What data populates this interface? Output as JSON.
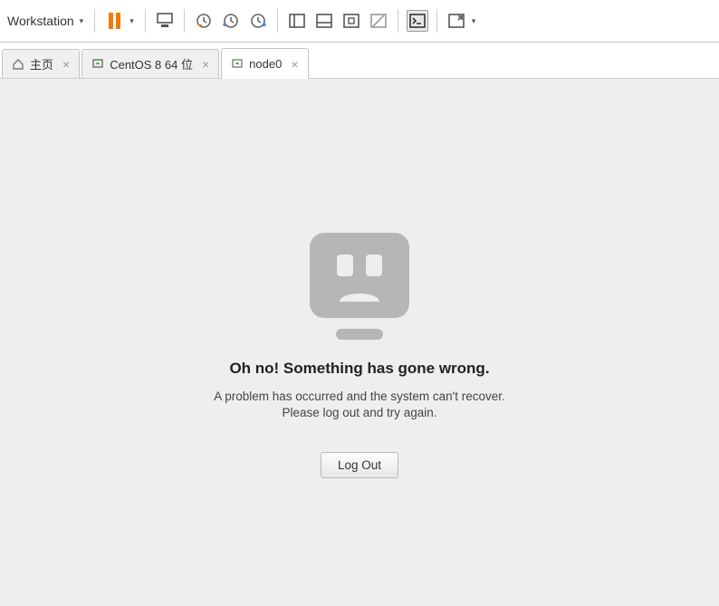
{
  "toolbar": {
    "workstation_label": "Workstation",
    "dropdown_suffix": "▼"
  },
  "tabs": [
    {
      "label": "主页",
      "type": "home"
    },
    {
      "label": "CentOS 8 64 位",
      "type": "vm"
    },
    {
      "label": "node0",
      "type": "vm"
    }
  ],
  "error": {
    "title": "Oh no!  Something has gone wrong.",
    "line1": "A problem has occurred and the system can't recover.",
    "line2": "Please log out and try again.",
    "button": "Log Out"
  }
}
